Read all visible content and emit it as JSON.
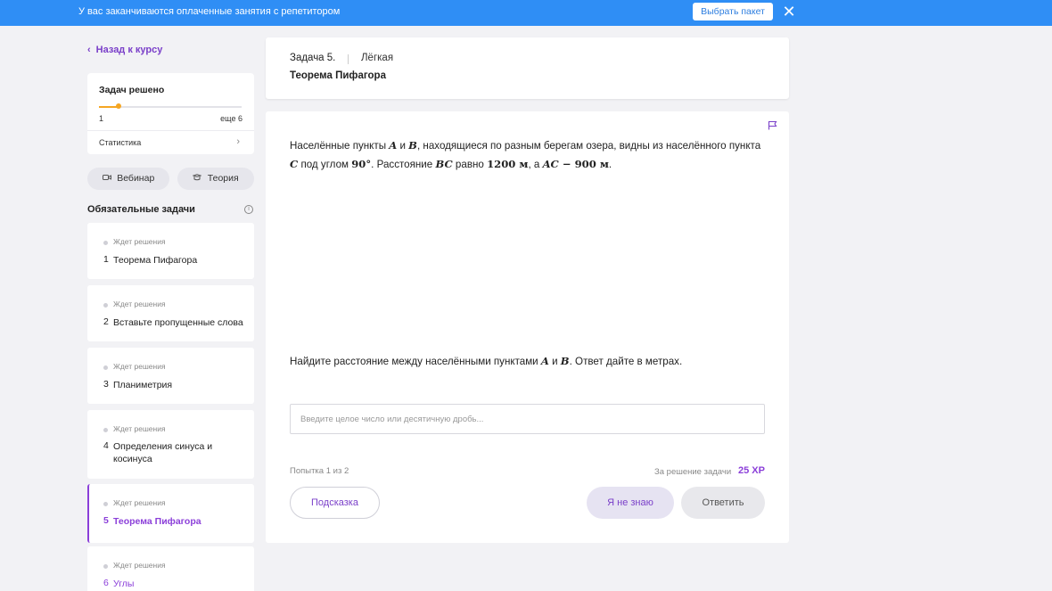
{
  "banner": {
    "text": "У вас заканчиваются оплаченные занятия с репетитором",
    "button_label": "Выбрать пакет",
    "close_icon": "✕"
  },
  "sidebar": {
    "back_label": "Назад к курсу",
    "back_icon": "‹",
    "progress": {
      "title": "Задач решено",
      "solved": "1",
      "remaining": "еще 6",
      "fraction": 0.14,
      "stats_label": "Статистика",
      "stats_icon": "›"
    },
    "pills": [
      {
        "label": "Вебинар",
        "icon": "camera-icon"
      },
      {
        "label": "Теория",
        "icon": "book-icon"
      }
    ],
    "section_title": "Обязательные задачи",
    "tasks": [
      {
        "status": "Ждет решения",
        "num": "1",
        "title": "Теорема Пифагора"
      },
      {
        "status": "Ждет решения",
        "num": "2",
        "title": "Вставьте пропущенные слова"
      },
      {
        "status": "Ждет решения",
        "num": "3",
        "title": "Планиметрия"
      },
      {
        "status": "Ждет решения",
        "num": "4",
        "title": "Определения синуса и косинуса"
      },
      {
        "status": "Ждет решения",
        "num": "5",
        "title": "Теорема Пифагора"
      },
      {
        "status": "Ждет решения",
        "num": "6",
        "title": "Углы"
      }
    ]
  },
  "header": {
    "task_no": "Задача 5.",
    "level": "Лёгкая",
    "topic": "Теорема Пифагора"
  },
  "problem": {
    "part1": "Населённые пункты ",
    "A": "A",
    "and": " и ",
    "B": "B",
    "part2": ", находящиеся по разным берегам озера, видны из населённого пункта ",
    "C": "C",
    "part3": " под углом ",
    "angle": "90°",
    "part4": ". Расстояние ",
    "BC": "BC",
    "part5": " равно ",
    "bc_val": "1200 м",
    "part6": ", а ",
    "AC": "AC",
    "part7": " − ",
    "ac_val": "900 м",
    "part8": "."
  },
  "question": {
    "part1": "Найдите расстояние между населёнными пунктами ",
    "A": "A",
    "and": " и ",
    "B": "B",
    "part2": ". Ответ дайте в метрах."
  },
  "answer": {
    "placeholder": "Введите целое число или десятичную дробь...",
    "value": ""
  },
  "footer": {
    "attempt": "Попытка 1 из 2",
    "reward_label": "За решение задачи",
    "reward_value": "25 XP",
    "hint_label": "Подсказка",
    "dontknow_label": "Я не знаю",
    "answer_label": "Ответить"
  }
}
